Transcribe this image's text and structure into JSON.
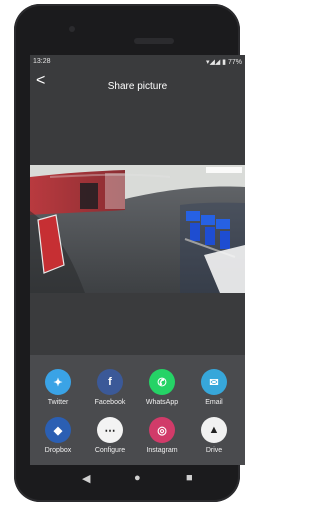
{
  "status": {
    "time": "13:28",
    "battery": "77%"
  },
  "header": {
    "title": "Share picture"
  },
  "share_items": [
    {
      "label": "Twitter",
      "icon": "twitter-icon",
      "color": "#3aa3e6"
    },
    {
      "label": "Facebook",
      "icon": "facebook-icon",
      "color": "#3b5998"
    },
    {
      "label": "WhatsApp",
      "icon": "whatsapp-icon",
      "color": "#25d366"
    },
    {
      "label": "Email",
      "icon": "email-icon",
      "color": "#37a7da"
    },
    {
      "label": "Dropbox",
      "icon": "dropbox-icon",
      "color": "#2b5fb3"
    },
    {
      "label": "Configure",
      "icon": "more-icon",
      "color": "#f3f3f3"
    },
    {
      "label": "Instagram",
      "icon": "instagram-icon",
      "color": "#d13b69"
    },
    {
      "label": "Drive",
      "icon": "drive-icon",
      "color": "#f1f1f1"
    }
  ],
  "nav": {
    "back": "◀",
    "home": "●",
    "recent": "■"
  }
}
